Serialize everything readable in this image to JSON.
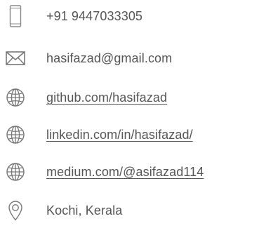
{
  "contact": {
    "phone": {
      "icon": "smartphone-icon",
      "text": "+91 9447033305"
    },
    "email": {
      "icon": "envelope-icon",
      "text": "hasifazad@gmail.com"
    },
    "github": {
      "icon": "globe-icon",
      "text": "github.com/hasifazad"
    },
    "linkedin": {
      "icon": "globe-icon",
      "text": "linkedin.com/in/hasifazad/"
    },
    "medium": {
      "icon": "globe-icon",
      "text": "medium.com/@asifazad114"
    },
    "location": {
      "icon": "location-pin-icon",
      "text": "Kochi, Kerala"
    }
  },
  "colors": {
    "text": "#555555",
    "icon": "#777777"
  }
}
